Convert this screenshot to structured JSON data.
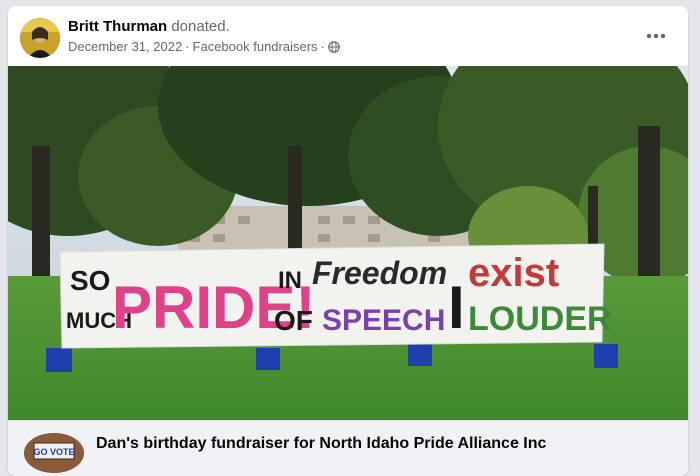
{
  "post": {
    "author": "Britt Thurman",
    "action": "donated.",
    "date": "December 31, 2022",
    "separator": "·",
    "source": "Facebook fundraisers",
    "separator2": "·",
    "audience_icon": "globe-icon",
    "more_icon": "more-options-icon"
  },
  "banner": {
    "line1a": "SO",
    "line1b": "MUCH",
    "pride": "PRIDE!",
    "in": "IN",
    "of": "OF",
    "freedom": "Freedom",
    "speech": "SPEECH",
    "exist_i": "I",
    "exist": "exist",
    "louder": "LOUDER"
  },
  "fundraiser": {
    "title": "Dan's birthday fundraiser for North Idaho Pride Alliance Inc",
    "thumb_text": "GO VOTE"
  },
  "colors": {
    "page_bg": "#e4e6eb",
    "card_bg": "#ffffff",
    "text_primary": "#050505",
    "text_secondary": "#65676b"
  }
}
